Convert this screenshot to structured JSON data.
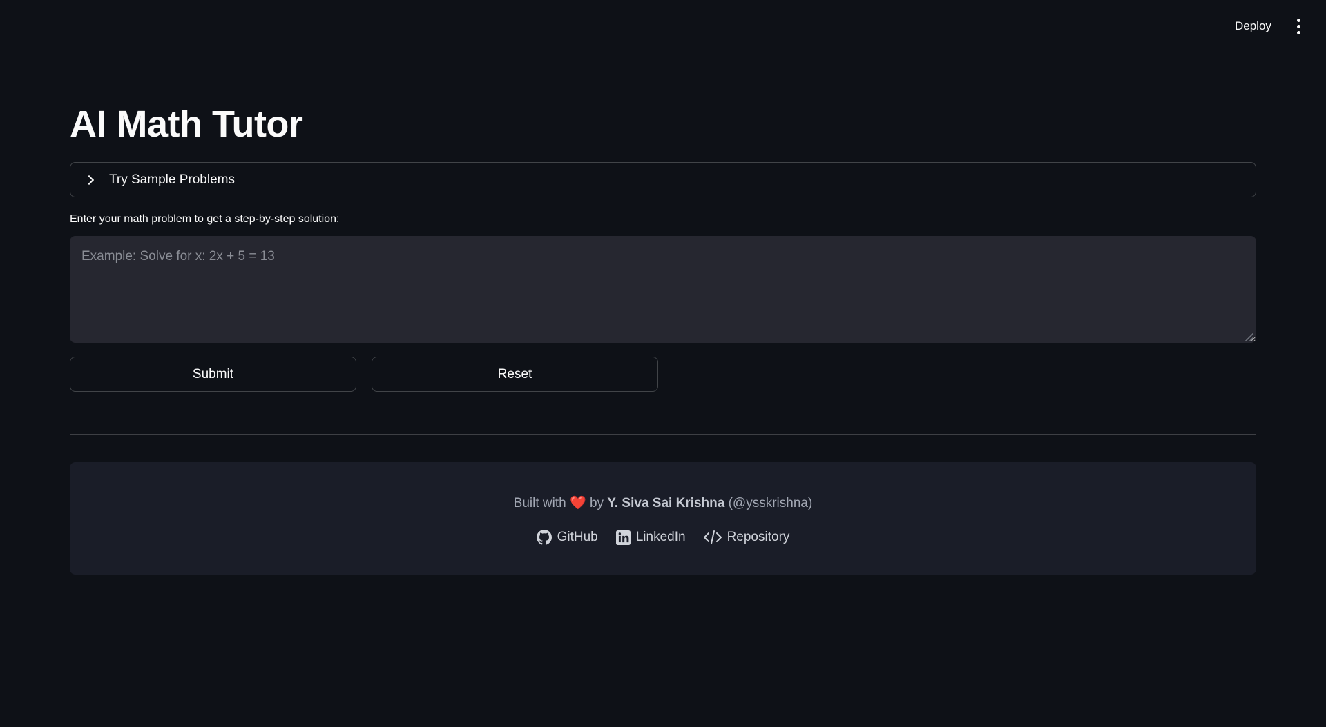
{
  "header": {
    "deploy_label": "Deploy",
    "menu_icon": "more-vertical-icon"
  },
  "main": {
    "title": "AI Math Tutor",
    "expander": {
      "label": "Try Sample Problems",
      "icon": "chevron-right-icon"
    },
    "problem_input": {
      "label": "Enter your math problem to get a step-by-step solution:",
      "placeholder": "Example: Solve for x: 2x + 5 = 13",
      "value": ""
    },
    "buttons": {
      "submit_label": "Submit",
      "reset_label": "Reset"
    }
  },
  "footer": {
    "built_with": "Built with",
    "heart": "❤️",
    "by": "by",
    "author_name": "Y. Siva Sai Krishna",
    "author_handle": "(@ysskrishna)",
    "links": [
      {
        "label": "GitHub",
        "icon": "github-icon"
      },
      {
        "label": "LinkedIn",
        "icon": "linkedin-icon"
      },
      {
        "label": "Repository",
        "icon": "code-icon"
      }
    ]
  },
  "colors": {
    "background": "#0e1117",
    "input_background": "#262730",
    "footer_background": "#1a1d28",
    "text": "#fafafa",
    "heart": "#e03131"
  }
}
